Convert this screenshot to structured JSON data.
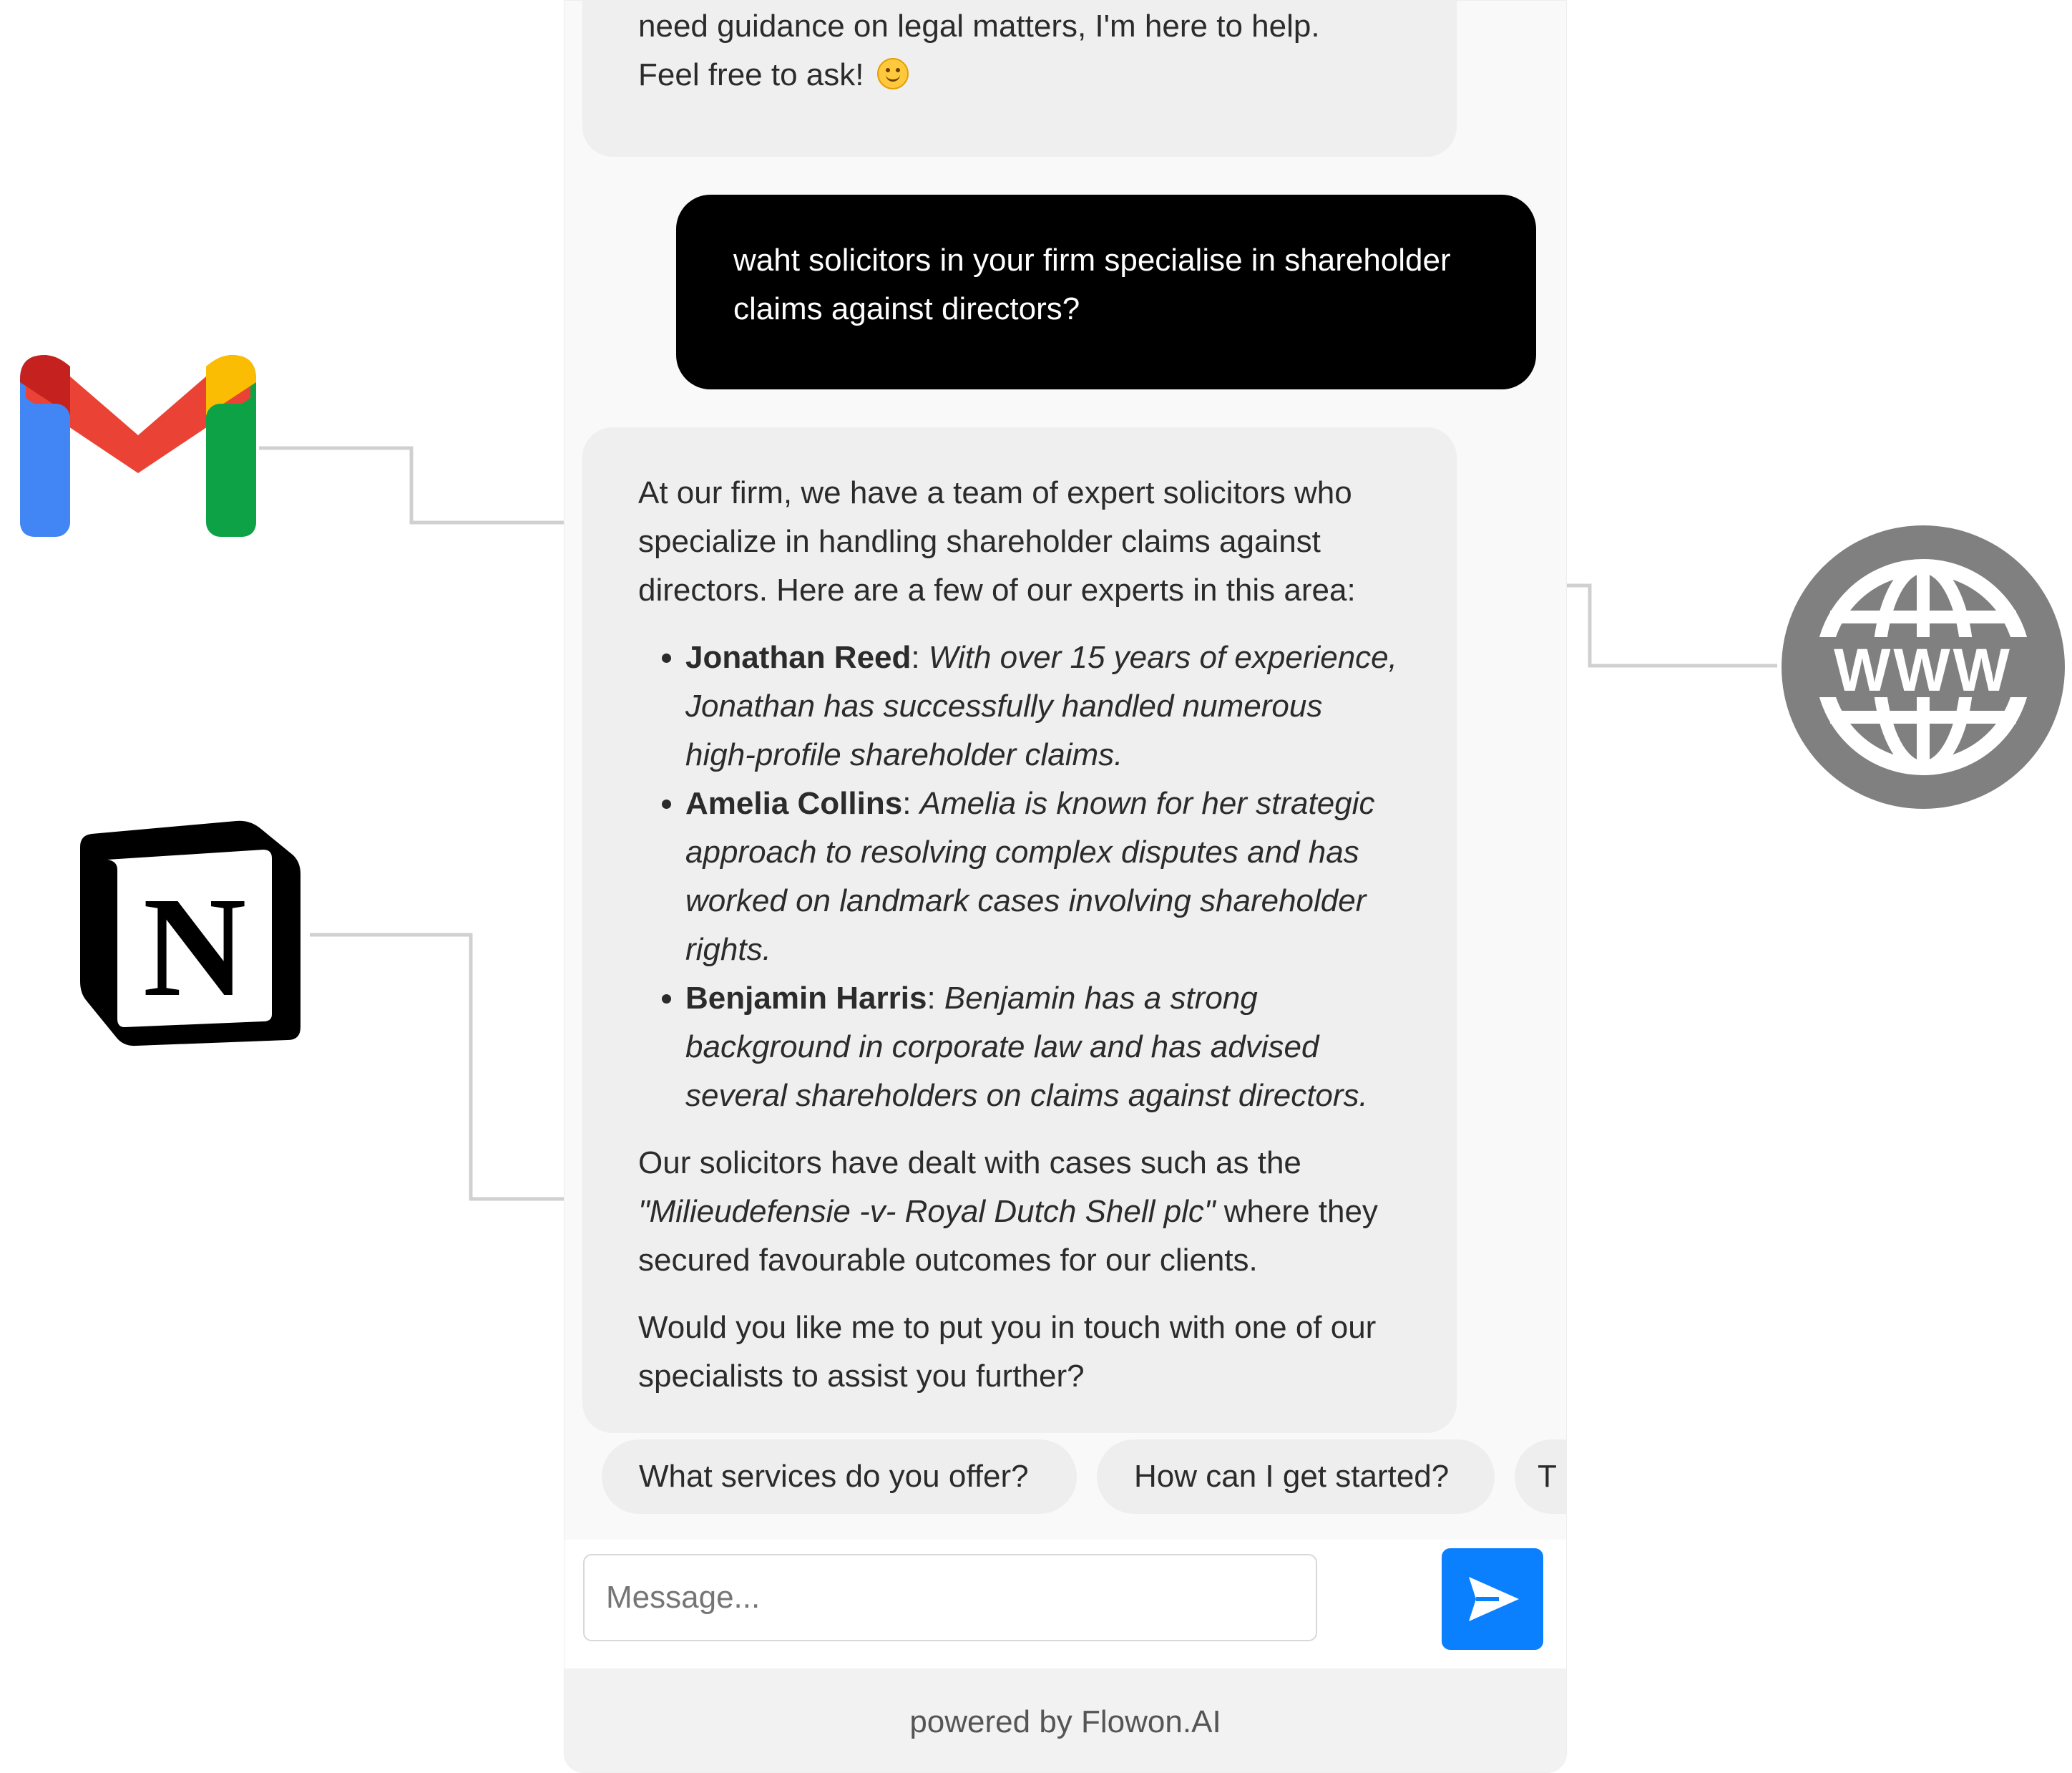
{
  "chat": {
    "intro_partial": {
      "line1": "need guidance on legal matters, I'm here to help.",
      "line2": "Feel free to ask!",
      "emoji": "smiling-face"
    },
    "user_message": "waht solicitors in your firm specialise in shareholder claims against directors?",
    "response": {
      "intro": "At our firm, we have a team of expert solicitors who specialize in handling shareholder claims against directors. Here are a few of our experts in this area:",
      "experts": [
        {
          "name": "Jonathan Reed",
          "desc": "With over 15 years of experience, Jonathan has successfully handled numerous high-profile shareholder claims."
        },
        {
          "name": "Amelia Collins",
          "desc": "Amelia is known for her strategic approach to resolving complex disputes and has worked on landmark cases involving shareholder rights."
        },
        {
          "name": "Benjamin Harris",
          "desc": "Benjamin has a strong background in corporate law and has advised several shareholders on claims against directors."
        }
      ],
      "cases_before": "Our solicitors have dealt with cases such as the",
      "case_name": "\"Milieudefensie -v- Royal Dutch Shell plc\"",
      "cases_after": "where they secured favourable outcomes for our clients.",
      "closing": "Would you like me to put you in touch with one of our specialists to assist you further?"
    }
  },
  "suggestions": [
    "What services do you offer?",
    "How can I get started?",
    "T"
  ],
  "composer": {
    "placeholder": "Message...",
    "send_icon": "send-arrow-icon"
  },
  "footer": {
    "powered_by": "powered by Flowon.AI"
  },
  "integrations": [
    {
      "name": "gmail-logo"
    },
    {
      "name": "notion-logo",
      "glyph": "N"
    },
    {
      "name": "website-globe-logo",
      "glyph": "WWW"
    }
  ],
  "colors": {
    "user_bubble": "#000000",
    "bot_bubble": "#efefef",
    "send_button": "#0a80ff",
    "connector": "#d0d0d0",
    "globe": "#808080"
  }
}
